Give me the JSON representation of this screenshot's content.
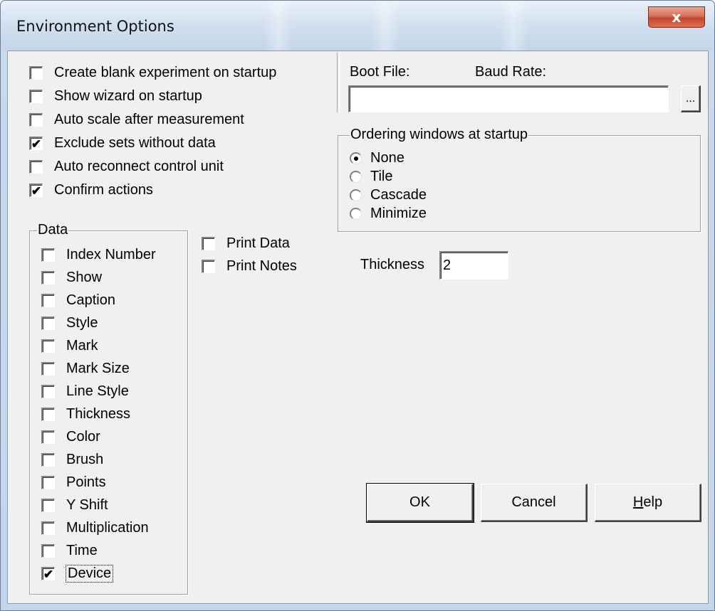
{
  "window": {
    "title": "Environment Options",
    "close_glyph": "x"
  },
  "options": [
    {
      "label": "Create blank experiment on startup",
      "checked": false
    },
    {
      "label": "Show wizard on startup",
      "checked": false
    },
    {
      "label": "Auto scale after measurement",
      "checked": false
    },
    {
      "label": "Exclude sets without data",
      "checked": true
    },
    {
      "label": "Auto reconnect control unit",
      "checked": false
    },
    {
      "label": "Confirm actions",
      "checked": true
    }
  ],
  "boot": {
    "boot_file_label": "Boot File:",
    "baud_rate_label": "Baud Rate:",
    "boot_file_value": "",
    "browse_label": "..."
  },
  "ordering": {
    "group_label": "Ordering windows at startup",
    "options": [
      "None",
      "Tile",
      "Cascade",
      "Minimize"
    ],
    "selected": "None"
  },
  "data_group": {
    "label": "Data",
    "items": [
      {
        "label": "Index Number",
        "checked": false
      },
      {
        "label": "Show",
        "checked": false
      },
      {
        "label": "Caption",
        "checked": false
      },
      {
        "label": "Style",
        "checked": false
      },
      {
        "label": "Mark",
        "checked": false
      },
      {
        "label": "Mark Size",
        "checked": false
      },
      {
        "label": "Line Style",
        "checked": false
      },
      {
        "label": "Thickness",
        "checked": false
      },
      {
        "label": "Color",
        "checked": false
      },
      {
        "label": "Brush",
        "checked": false
      },
      {
        "label": "Points",
        "checked": false
      },
      {
        "label": "Y Shift",
        "checked": false
      },
      {
        "label": "Multiplication",
        "checked": false
      },
      {
        "label": "Time",
        "checked": false
      },
      {
        "label": "Device",
        "checked": true
      }
    ]
  },
  "print": [
    {
      "label": "Print Data",
      "checked": false
    },
    {
      "label": "Print Notes",
      "checked": false
    }
  ],
  "thickness": {
    "label": "Thickness",
    "value": "2"
  },
  "buttons": {
    "ok": "OK",
    "cancel": "Cancel",
    "help": "Help",
    "help_mnemonic": "H",
    "help_rest": "elp"
  }
}
